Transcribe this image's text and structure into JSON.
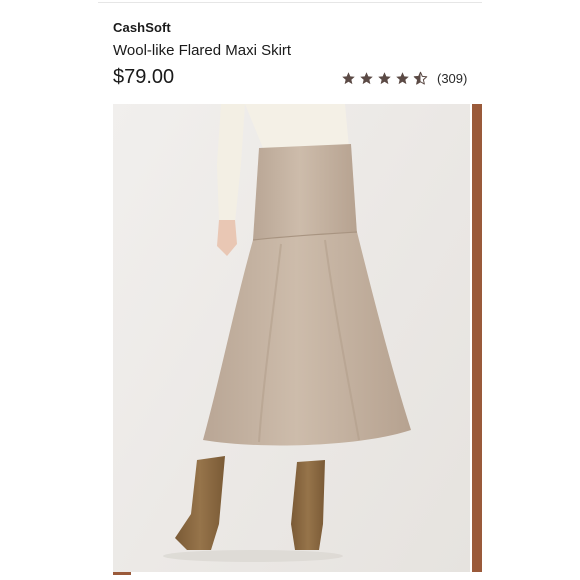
{
  "product": {
    "brand": "CashSoft",
    "name": "Wool-like Flared Maxi Skirt",
    "price": "$79.00"
  },
  "rating": {
    "value": 4.5,
    "max": 5,
    "count_text": "(309)"
  },
  "colors": {
    "star": "#5b4a45",
    "accent_edge": "#9a5a3a",
    "skirt": "#c8b6a4",
    "boots": "#8c6a43"
  },
  "icons": {
    "star": "star-icon",
    "half_star": "half-star-icon"
  }
}
